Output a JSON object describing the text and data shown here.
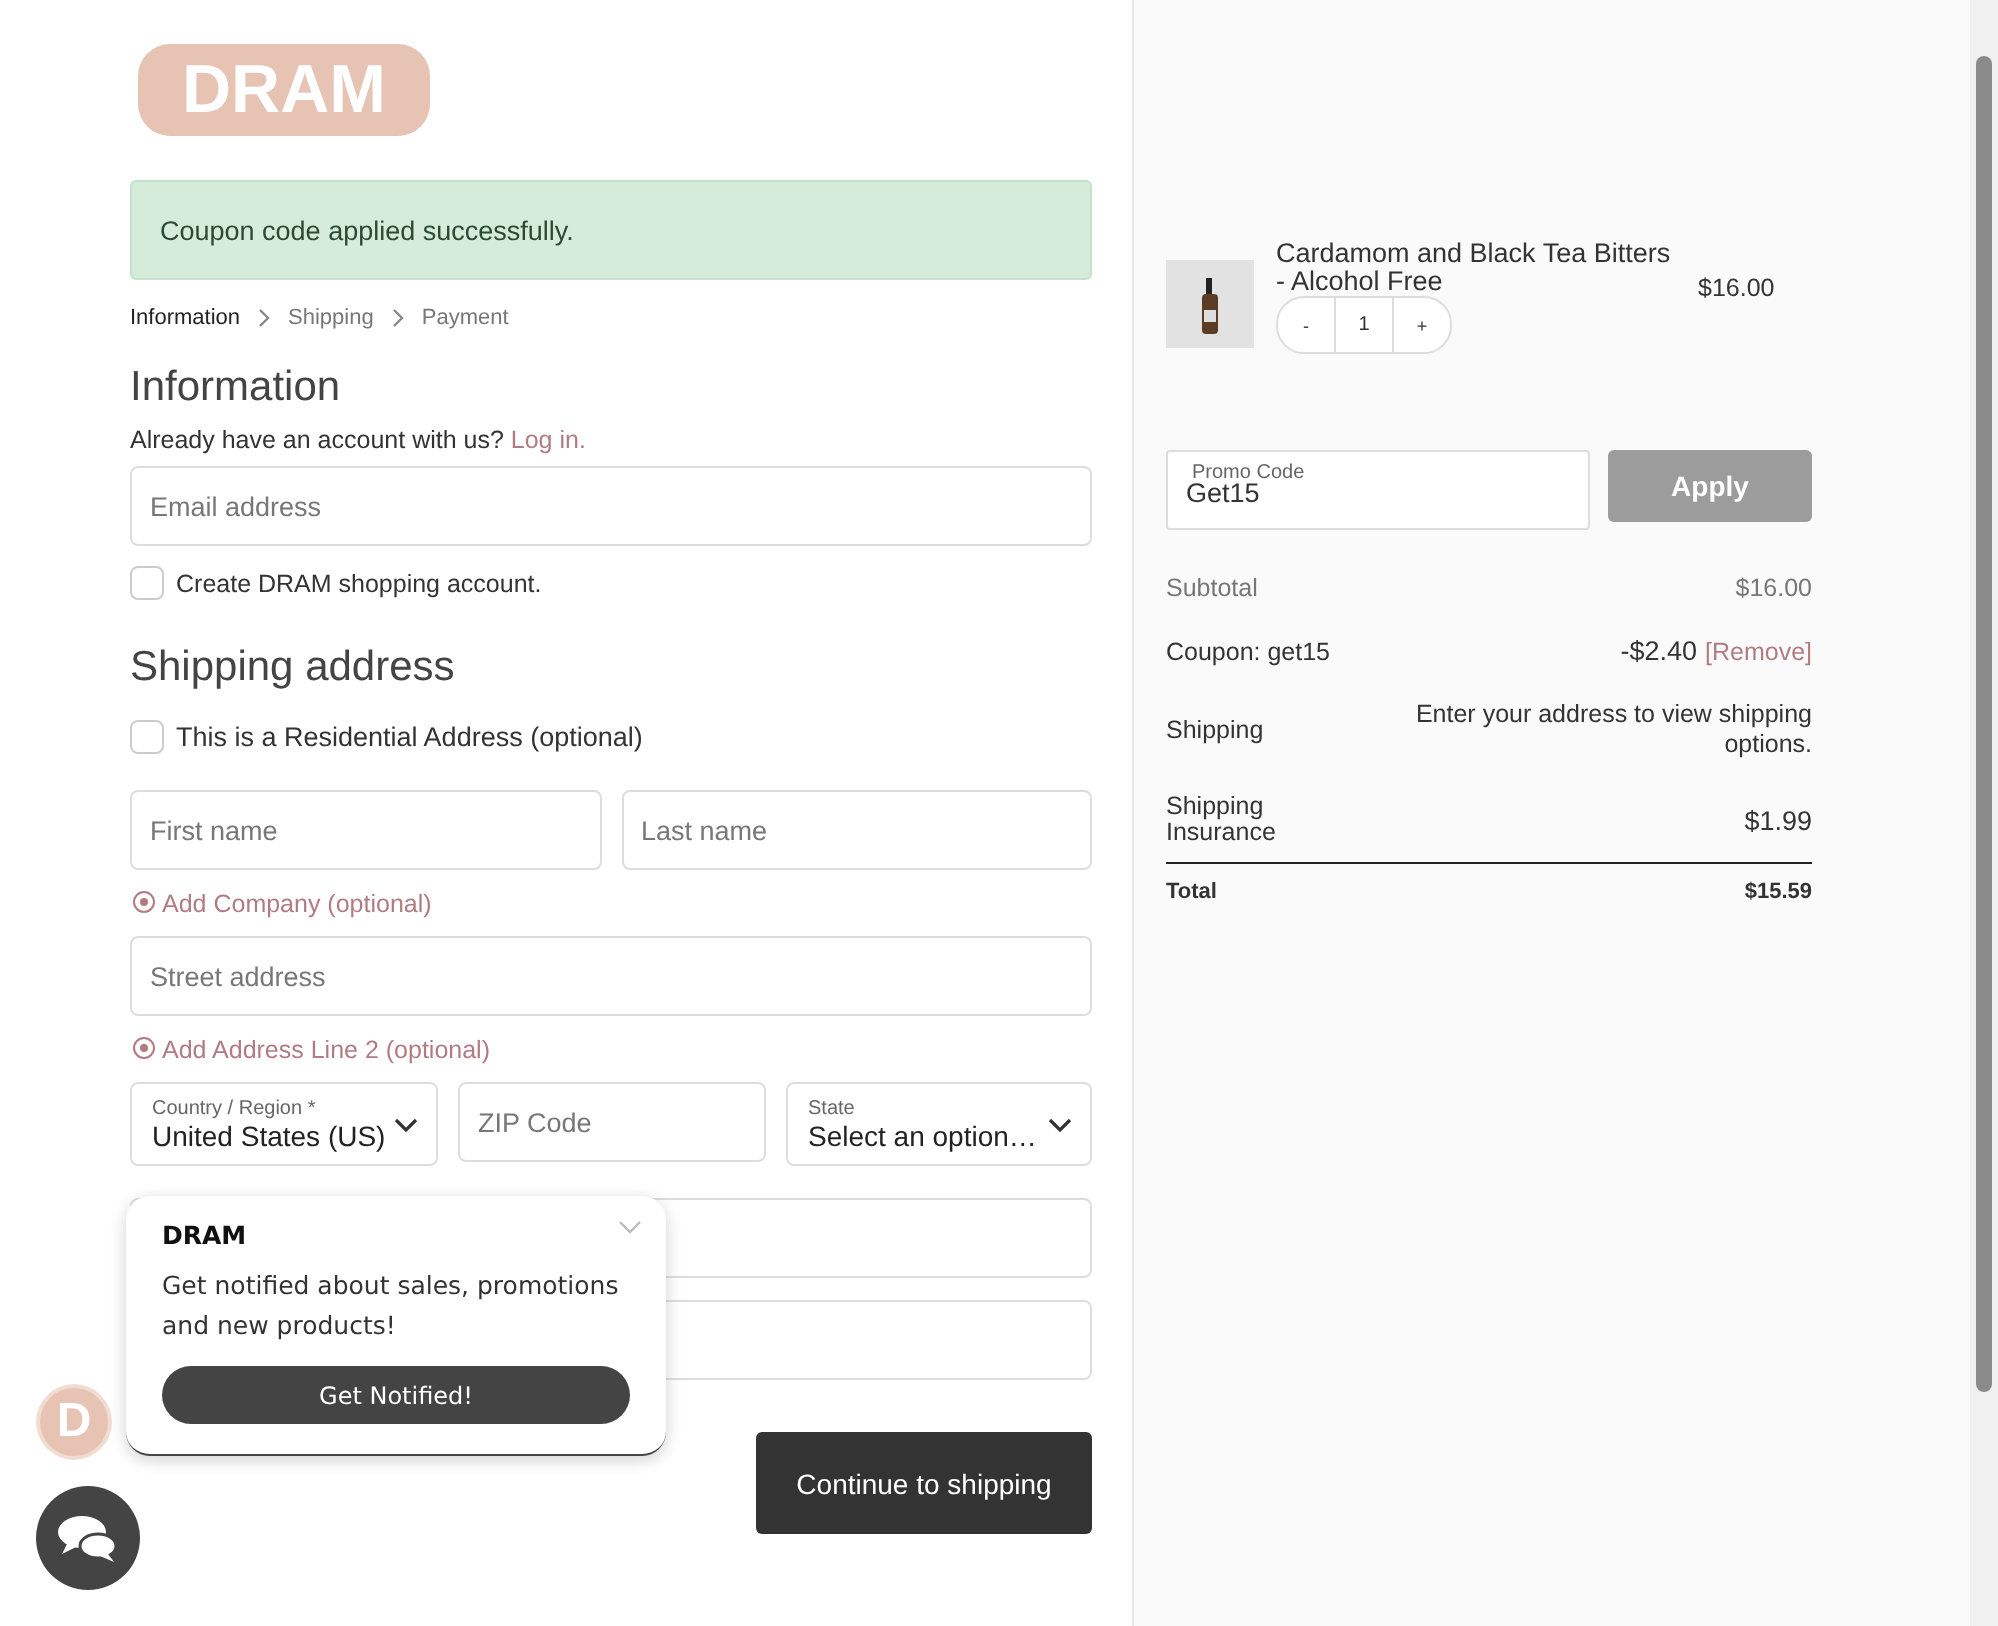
{
  "logo": {
    "text": "DRAM"
  },
  "alert": {
    "text": "Coupon code applied successfully."
  },
  "breadcrumb": [
    {
      "label": "Information",
      "selected": true
    },
    {
      "label": "Shipping",
      "selected": false
    },
    {
      "label": "Payment",
      "selected": false
    }
  ],
  "information": {
    "heading": "Information",
    "account_prompt": "Already have an account with us?",
    "login_link": "Log in.",
    "email": {
      "placeholder": "Email address"
    },
    "create_account": {
      "label": "Create DRAM shopping account.",
      "checked": false
    }
  },
  "shipping": {
    "heading": "Shipping address",
    "residential": {
      "label": "This is a Residential Address (optional)",
      "checked": false
    },
    "first_name": {
      "placeholder": "First name"
    },
    "last_name": {
      "placeholder": "Last name"
    },
    "add_company": "Add Company (optional)",
    "street": {
      "placeholder": "Street address"
    },
    "add_line2": "Add Address Line 2 (optional)",
    "country": {
      "label": "Country / Region *",
      "value": "United States (US)"
    },
    "zip": {
      "placeholder": "ZIP Code"
    },
    "state": {
      "label": "State",
      "value": "Select an option…"
    },
    "extra_fields": [
      {
        "kind": "field"
      },
      {
        "kind": "field"
      }
    ],
    "continue_button": "Continue to shipping"
  },
  "order": {
    "item": {
      "name": "Cardamom and Black Tea Bitters - Alcohol Free",
      "minus": "-",
      "quantity": "1",
      "plus": "+",
      "price": "$16.00"
    },
    "promo": {
      "label": "Promo Code",
      "value": "Get15",
      "button": "Apply"
    },
    "totals": [
      {
        "kind": "muted",
        "label": "Subtotal",
        "value": "$16.00"
      },
      {
        "kind": "coupon",
        "label": "Coupon: get15",
        "value": "-$2.40",
        "link": "[Remove]"
      },
      {
        "kind": "note",
        "label": "Shipping",
        "value": "Enter your address to view shipping options."
      },
      {
        "kind": "plain",
        "label": "Shipping Insurance",
        "value": "$1.99"
      },
      {
        "kind": "total",
        "label": "Total",
        "value": "$15.59"
      }
    ]
  },
  "popup": {
    "title": "DRAM",
    "message": "Get notified about sales, promotions and new products!",
    "button": "Get Notified!"
  },
  "badge": {
    "text": "D"
  }
}
